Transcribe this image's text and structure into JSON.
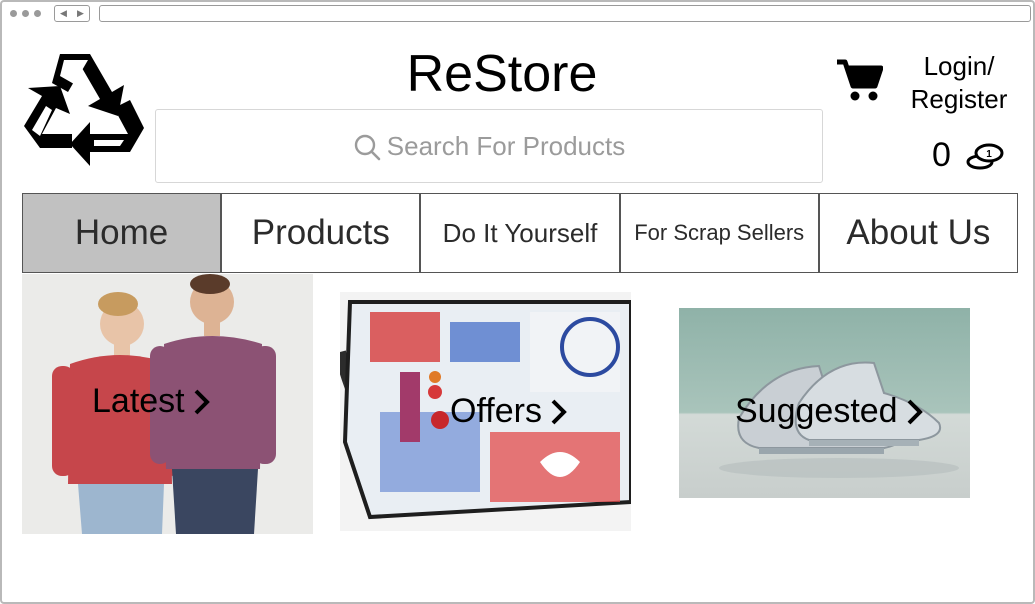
{
  "window": {
    "url": ""
  },
  "header": {
    "brand_title": "ReStore",
    "search_placeholder": "Search For Products",
    "login_line1": "Login/",
    "login_line2": "Register",
    "coin_count": "0",
    "coin_badge": "1"
  },
  "icons": {
    "logo": "recycle-icon",
    "search": "search-icon",
    "cart": "cart-icon",
    "coins": "coins-icon",
    "chevron": "chevron-right-icon"
  },
  "nav": {
    "items": [
      {
        "label": "Home",
        "active": true
      },
      {
        "label": "Products",
        "active": false
      },
      {
        "label": "Do It Yourself",
        "active": false
      },
      {
        "label": "For Scrap Sellers",
        "active": false
      },
      {
        "label": "About Us",
        "active": false
      }
    ]
  },
  "tiles": [
    {
      "label": "Latest"
    },
    {
      "label": "Offers"
    },
    {
      "label": "Suggested"
    }
  ],
  "colors": {
    "active_nav": "#c1c1c1",
    "border": "#555555",
    "placeholder": "#9b9b9b"
  }
}
